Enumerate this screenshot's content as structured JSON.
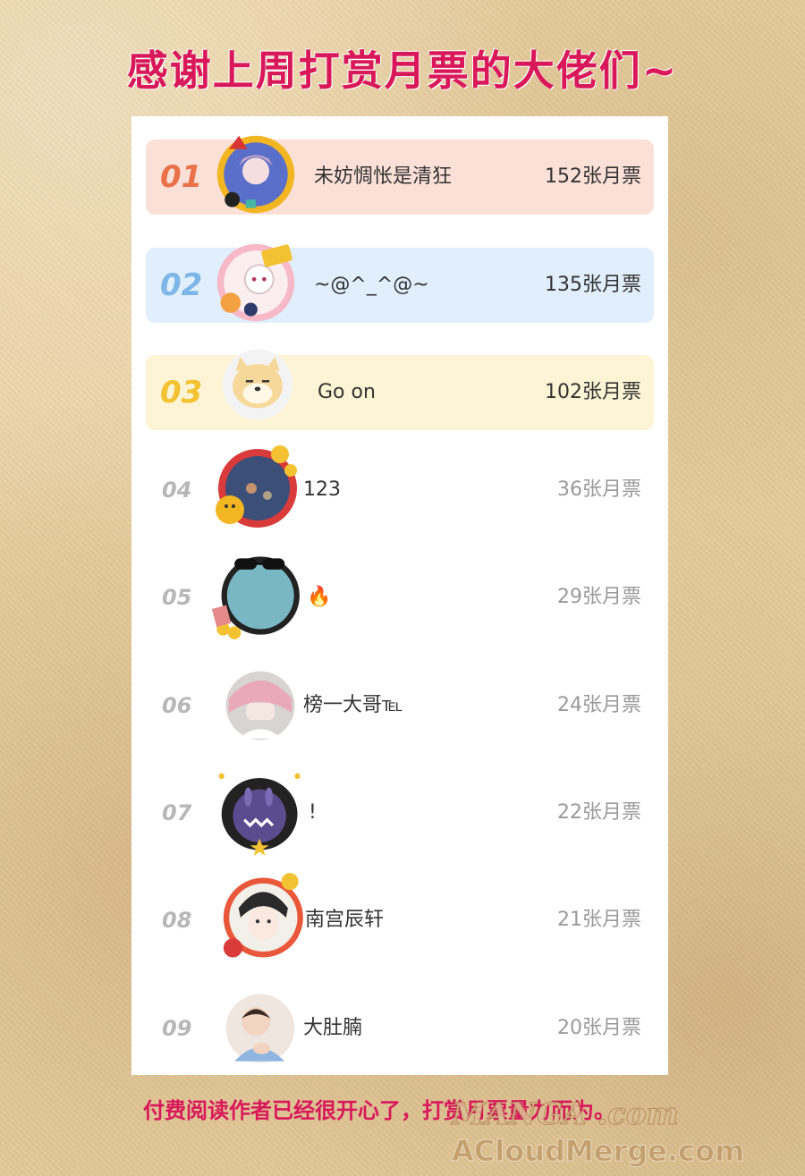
{
  "title": "感谢上周打赏月票的大佬们~",
  "footer_note": "付费阅读作者已经很开心了，打赏月票量力而为。",
  "watermark": {
    "line1": "MANGA .com",
    "line2": "ACloudMerge.com"
  },
  "colors": {
    "title": "#d9185a",
    "rank1_bg": "#fbe0d8",
    "rank1_text": "#e9724a",
    "rank2_bg": "#e1eefb",
    "rank2_text": "#7fb6e8",
    "rank3_bg": "#fcf4d4",
    "rank3_text": "#f2c232"
  },
  "ranking": [
    {
      "rank": "01",
      "name": "未妨惆怅是清狂",
      "tickets": "152张月票",
      "avatar_icon": "anime-boy-avatar-icon"
    },
    {
      "rank": "02",
      "name": "~@^_^@~",
      "tickets": "135张月票",
      "avatar_icon": "anime-girl-avatar-icon"
    },
    {
      "rank": "03",
      "name": "Go on",
      "tickets": "102张月票",
      "avatar_icon": "shiba-dog-avatar-icon"
    },
    {
      "rank": "04",
      "name": "123",
      "tickets": "36张月票",
      "avatar_icon": "lucky-cat-avatar-icon"
    },
    {
      "rank": "05",
      "name": "🔥",
      "tickets": "29张月票",
      "avatar_icon": "sunglasses-avatar-icon"
    },
    {
      "rank": "06",
      "name": "榜一大哥℡",
      "tickets": "24张月票",
      "avatar_icon": "pink-hair-avatar-icon"
    },
    {
      "rank": "07",
      "name": "!",
      "tickets": "22张月票",
      "avatar_icon": "penguin-avatar-icon"
    },
    {
      "rank": "08",
      "name": "南宫辰轩",
      "tickets": "21张月票",
      "avatar_icon": "anime-character-avatar-icon"
    },
    {
      "rank": "09",
      "name": "大肚腩",
      "tickets": "20张月票",
      "avatar_icon": "baby-avatar-icon"
    }
  ]
}
